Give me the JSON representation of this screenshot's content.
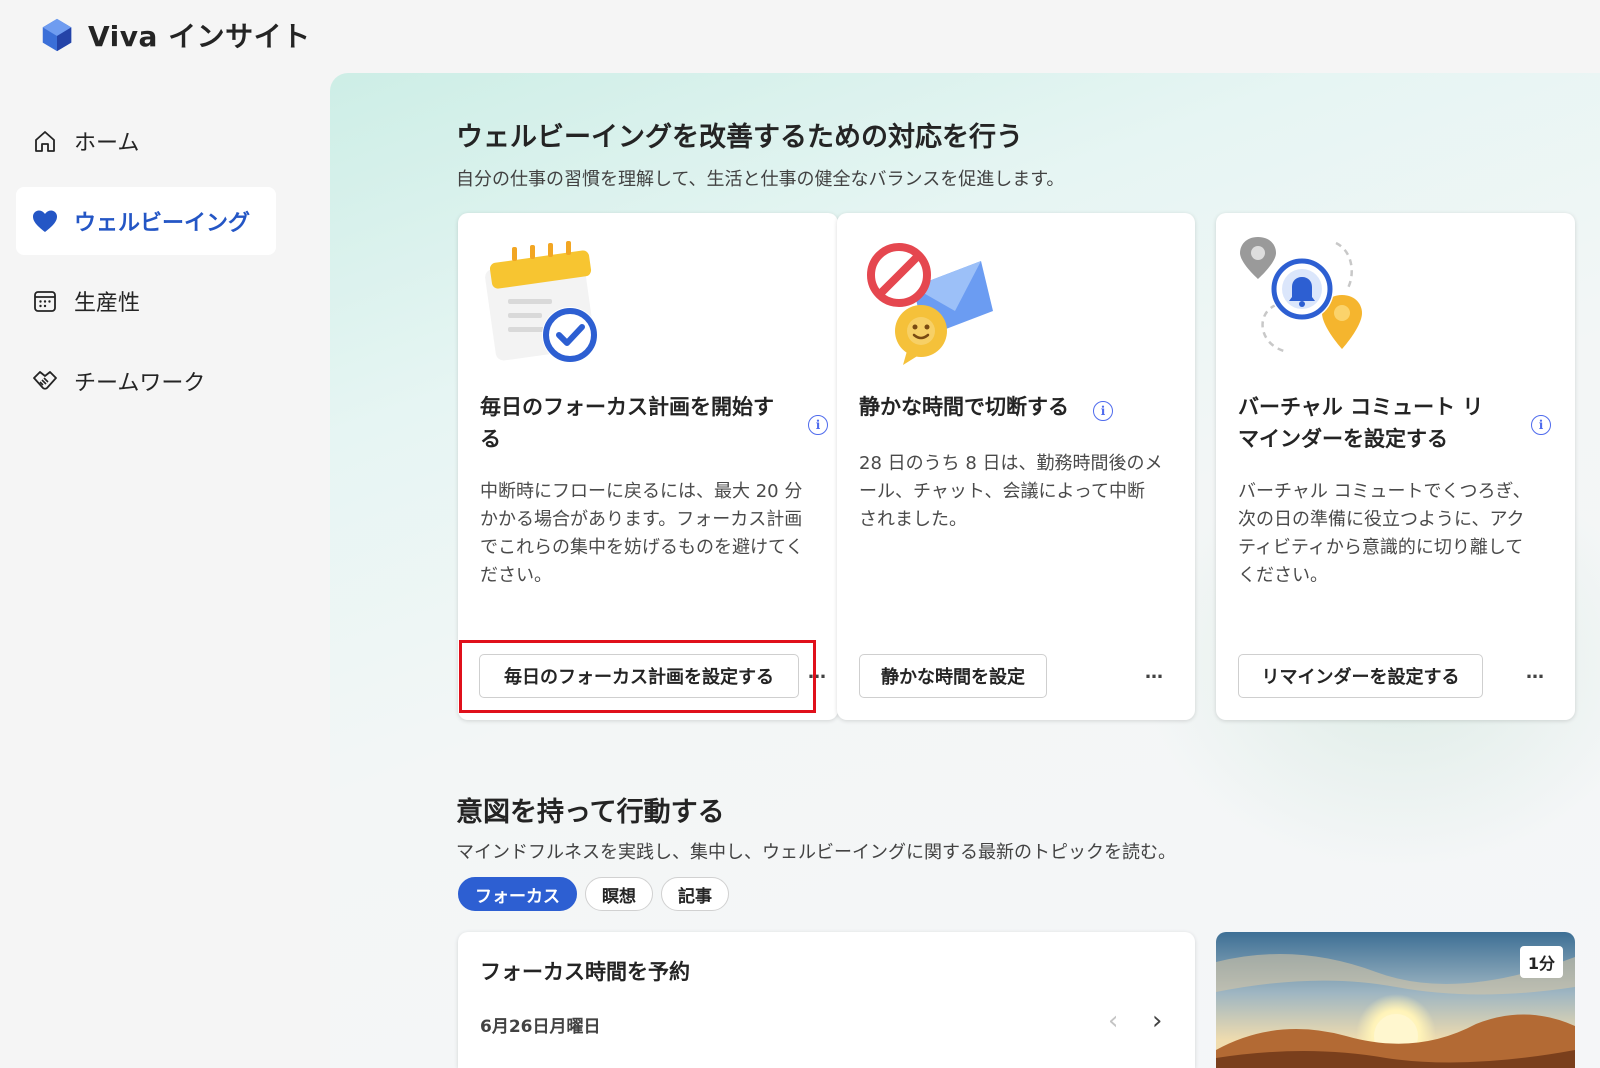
{
  "app": {
    "title": "Viva インサイト"
  },
  "sidebar": {
    "items": [
      {
        "label": "ホーム",
        "icon": "home-icon"
      },
      {
        "label": "ウェルビーイング",
        "icon": "heart-icon",
        "active": true
      },
      {
        "label": "生産性",
        "icon": "calendar-icon"
      },
      {
        "label": "チームワーク",
        "icon": "handshake-icon"
      }
    ]
  },
  "wellbeing": {
    "title": "ウェルビーイングを改善するための対応を行う",
    "subtitle": "自分の仕事の習慣を理解して、生活と仕事の健全なバランスを促進します。",
    "cards": [
      {
        "title_line1": "毎日のフォーカス計画を開始す",
        "title_line2": "る",
        "desc_lines": [
          "中断時にフローに戻るには、最大 20 分",
          "かかる場合があります。フォーカス計画",
          "でこれらの集中を妨げるものを避けてく",
          "ださい。"
        ],
        "button": "毎日のフォーカス計画を設定する",
        "more": "…"
      },
      {
        "title_line1": "静かな時間で切断する",
        "title_line2": "",
        "desc_lines": [
          "28 日のうち 8 日は、勤務時間後のメ",
          "ール、チャット、会議によって中断",
          "されました。"
        ],
        "button": "静かな時間を設定",
        "more": "…"
      },
      {
        "title_line1": "バーチャル コミュート リ",
        "title_line2": "マインダーを設定する",
        "desc_lines": [
          "バーチャル コミュートでくつろぎ、",
          "次の日の準備に役立つように、アク",
          "ティビティから意識的に切り離して",
          "ください。"
        ],
        "button": "リマインダーを設定する",
        "more": "…"
      }
    ]
  },
  "intent": {
    "title": "意図を持って行動する",
    "subtitle": "マインドフルネスを実践し、集中し、ウェルビーイングに関する最新のトピックを読む。",
    "tabs": [
      {
        "label": "フォーカス",
        "active": true
      },
      {
        "label": "瞑想"
      },
      {
        "label": "記事"
      }
    ],
    "focus_card": {
      "title": "フォーカス時間を予約",
      "date": "6月26日月曜日"
    },
    "media_card": {
      "duration": "1分"
    }
  },
  "colors": {
    "accent": "#2d5fd2",
    "highlight": "#e0101b",
    "info": "#4f6bed"
  }
}
